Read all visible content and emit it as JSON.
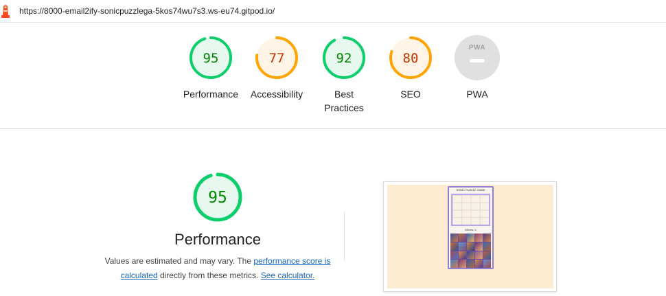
{
  "toolbar": {
    "url": "https://8000-email2ify-sonicpuzzlega-5kos74wu7s3.ws-eu74.gitpod.io/"
  },
  "categories": [
    {
      "label": "Performance",
      "score": "95",
      "status": "pass",
      "fraction": 0.95
    },
    {
      "label": "Accessibility",
      "score": "77",
      "status": "average",
      "fraction": 0.77
    },
    {
      "label": "Best Practices",
      "score": "92",
      "status": "pass",
      "fraction": 0.92
    },
    {
      "label": "SEO",
      "score": "80",
      "status": "average",
      "fraction": 0.8
    },
    {
      "label": "PWA",
      "badge": "PWA"
    }
  ],
  "performance_section": {
    "score": "95",
    "fraction": 0.95,
    "title": "Performance",
    "desc_prefix": "Values are estimated and may vary. The ",
    "link_score": "performance score is calculated",
    "desc_middle": " directly from these metrics. ",
    "link_calc": "See calculator."
  },
  "screenshot": {
    "page_title": "SONIC PUZZLE GAME",
    "moves_label": "Moves: 0"
  },
  "colors": {
    "pass_stroke": "#0cce6b",
    "pass_fill": "#e7f9ee",
    "pass_text": "#008800",
    "average_stroke": "#ffa400",
    "average_fill": "#fff4e6",
    "average_text": "#c33300",
    "pwa_grey": "#e0e0e0"
  }
}
